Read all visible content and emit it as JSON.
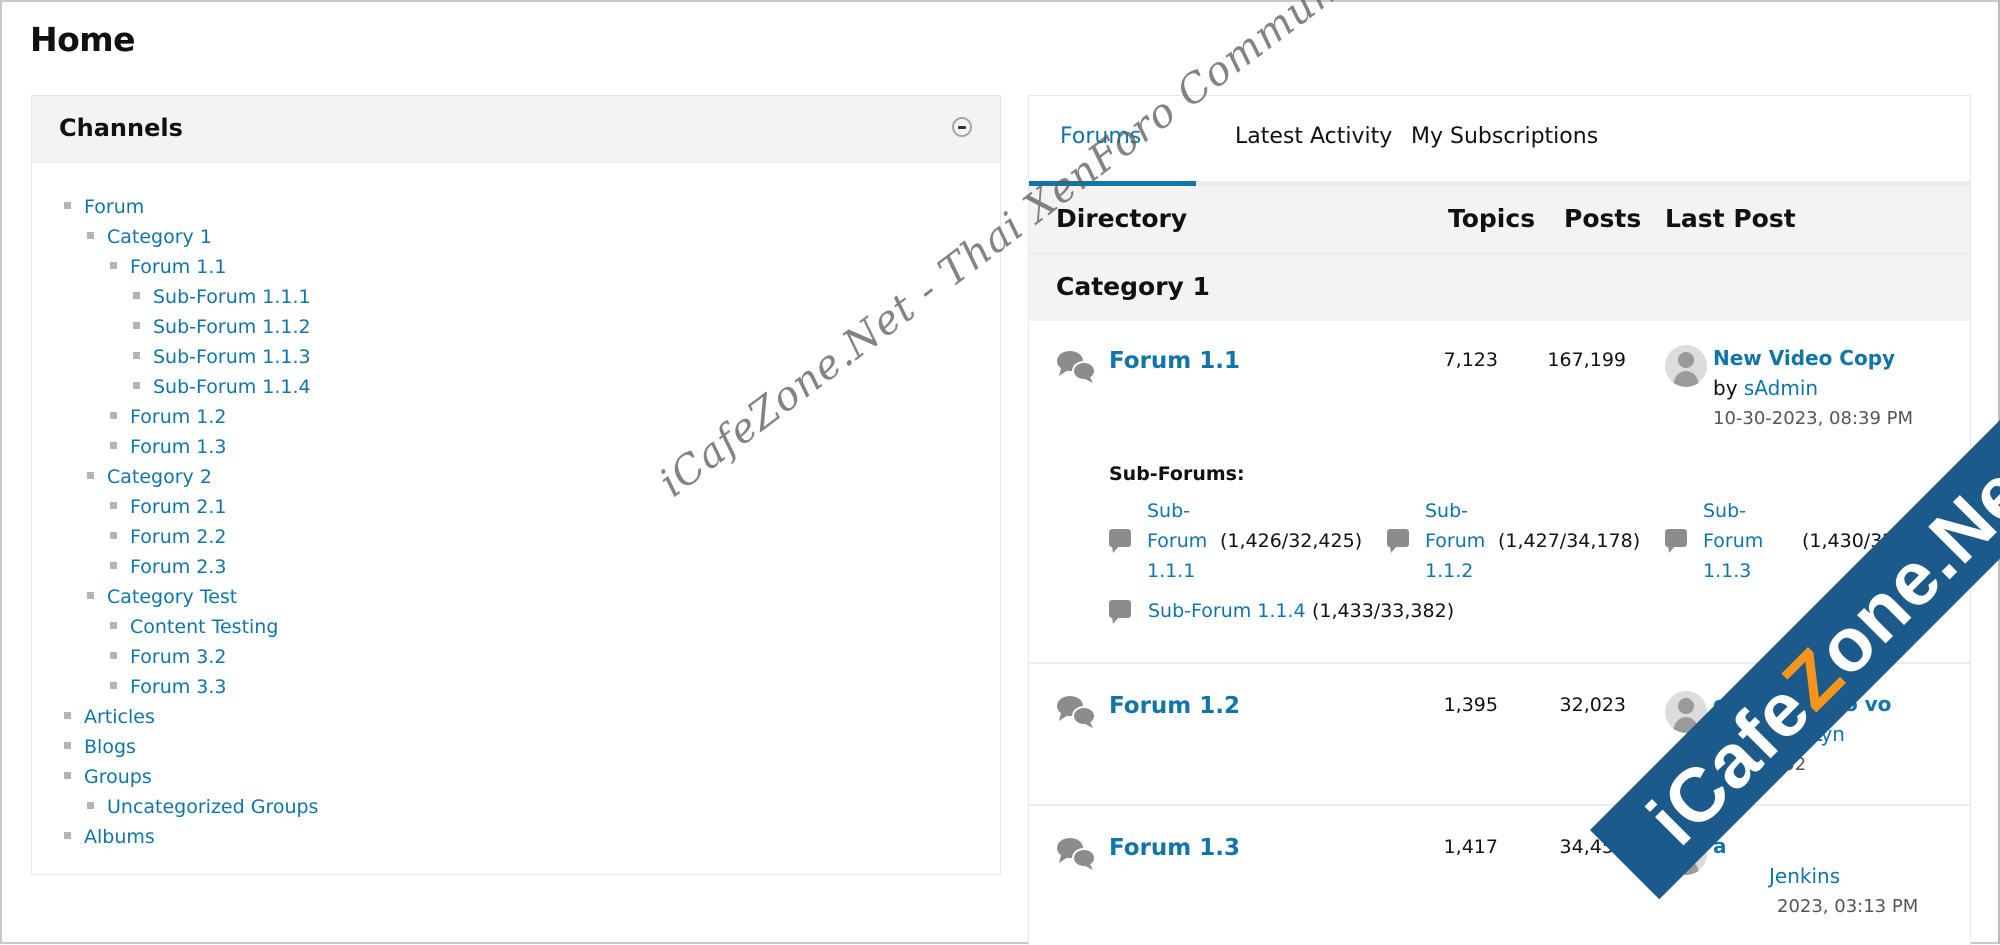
{
  "page": {
    "title": "Home"
  },
  "channels": {
    "title": "Channels",
    "collapse_icon": "minus-circle-icon",
    "tree": [
      {
        "label": "Forum",
        "level": 0
      },
      {
        "label": "Category 1",
        "level": 1
      },
      {
        "label": "Forum 1.1",
        "level": 2
      },
      {
        "label": "Sub-Forum 1.1.1",
        "level": 3
      },
      {
        "label": "Sub-Forum 1.1.2",
        "level": 3
      },
      {
        "label": "Sub-Forum 1.1.3",
        "level": 3
      },
      {
        "label": "Sub-Forum 1.1.4",
        "level": 3
      },
      {
        "label": "Forum 1.2",
        "level": 2
      },
      {
        "label": "Forum 1.3",
        "level": 2
      },
      {
        "label": "Category 2",
        "level": 1
      },
      {
        "label": "Forum 2.1",
        "level": 2
      },
      {
        "label": "Forum 2.2",
        "level": 2
      },
      {
        "label": "Forum 2.3",
        "level": 2
      },
      {
        "label": "Category Test",
        "level": 1
      },
      {
        "label": "Content Testing",
        "level": 2
      },
      {
        "label": "Forum 3.2",
        "level": 2
      },
      {
        "label": "Forum 3.3",
        "level": 2
      },
      {
        "label": "Articles",
        "level": 0
      },
      {
        "label": "Blogs",
        "level": 0
      },
      {
        "label": "Groups",
        "level": 0
      },
      {
        "label": "Uncategorized Groups",
        "level": 1
      },
      {
        "label": "Albums",
        "level": 0
      }
    ]
  },
  "forums_panel": {
    "tabs": [
      {
        "label": "Forums",
        "active": true
      },
      {
        "label": "Latest Activity",
        "active": false
      },
      {
        "label": "My Subscriptions",
        "active": false
      }
    ],
    "columns": {
      "directory": "Directory",
      "topics": "Topics",
      "posts": "Posts",
      "last_post": "Last Post"
    },
    "category": "Category 1",
    "sub_forums_label": "Sub-Forums:",
    "forums": [
      {
        "name": "Forum 1.1",
        "topics": "7,123",
        "posts": "167,199",
        "last_post": {
          "title": "New Video Copy",
          "by_prefix": "by",
          "author": "sAdmin",
          "date": "10-30-2023, 08:39 PM"
        },
        "sub_forums": [
          {
            "name_lines": [
              "Sub-",
              "Forum",
              "1.1.1"
            ],
            "count": "(1,426/32,425)"
          },
          {
            "name_lines": [
              "Sub-",
              "Forum",
              "1.1.2"
            ],
            "count": "(1,427/34,178)"
          },
          {
            "name_lines": [
              "Sub-",
              "Forum",
              "1.1.3"
            ],
            "count": "(1,430/32,780)"
          },
          {
            "name": "Sub-Forum 1.1.4",
            "count": "(1,433/33,382)"
          }
        ]
      },
      {
        "name": "Forum 1.2",
        "topics": "1,395",
        "posts": "32,023",
        "last_post": {
          "title": "et architecto vo",
          "by_prefix": "by",
          "author": "Alexie Lyn",
          "date": "09-06-202"
        }
      },
      {
        "name": "Forum 1.3",
        "topics": "1,417",
        "posts": "34,455",
        "last_post": {
          "title": "a",
          "by_prefix": "",
          "author": "Jenkins",
          "date": "2023, 03:13 PM"
        }
      }
    ]
  },
  "watermarks": {
    "diagonal_text": "iCafeZone.Net - Thai XenForo Community",
    "banner_parts": [
      "iCafe",
      "Z",
      "one.Net"
    ]
  },
  "colors": {
    "link": "#0f75aa",
    "header_bg": "#f4f2f3",
    "banner": "#1b5a8a",
    "banner_accent": "#f7941d"
  }
}
